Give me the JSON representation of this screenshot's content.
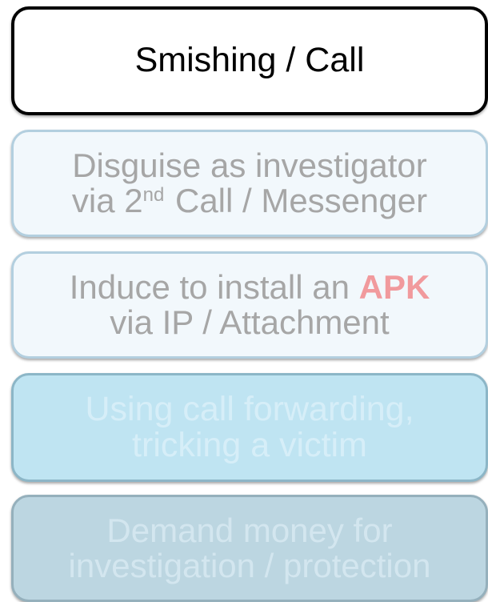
{
  "steps": [
    {
      "line1": "Smishing / Call"
    },
    {
      "line1": "Disguise as investigator",
      "line2_pre": "via 2",
      "line2_sup": "nd",
      "line2_post": " Call / Messenger"
    },
    {
      "line1_pre": "Induce to install an ",
      "line1_highlight": "APK",
      "line2": "via IP /  Attachment"
    },
    {
      "line1": "Using call forwarding,",
      "line2": "tricking a victim"
    },
    {
      "line1": "Demand money for",
      "line2": "investigation / protection"
    }
  ],
  "colors": {
    "step1_border": "#000000",
    "inactive_text": "#a6a6a6",
    "apk_highlight": "#f19a9d",
    "step4_fill": "#bfe4f2",
    "step5_fill": "#bcd6e1"
  }
}
